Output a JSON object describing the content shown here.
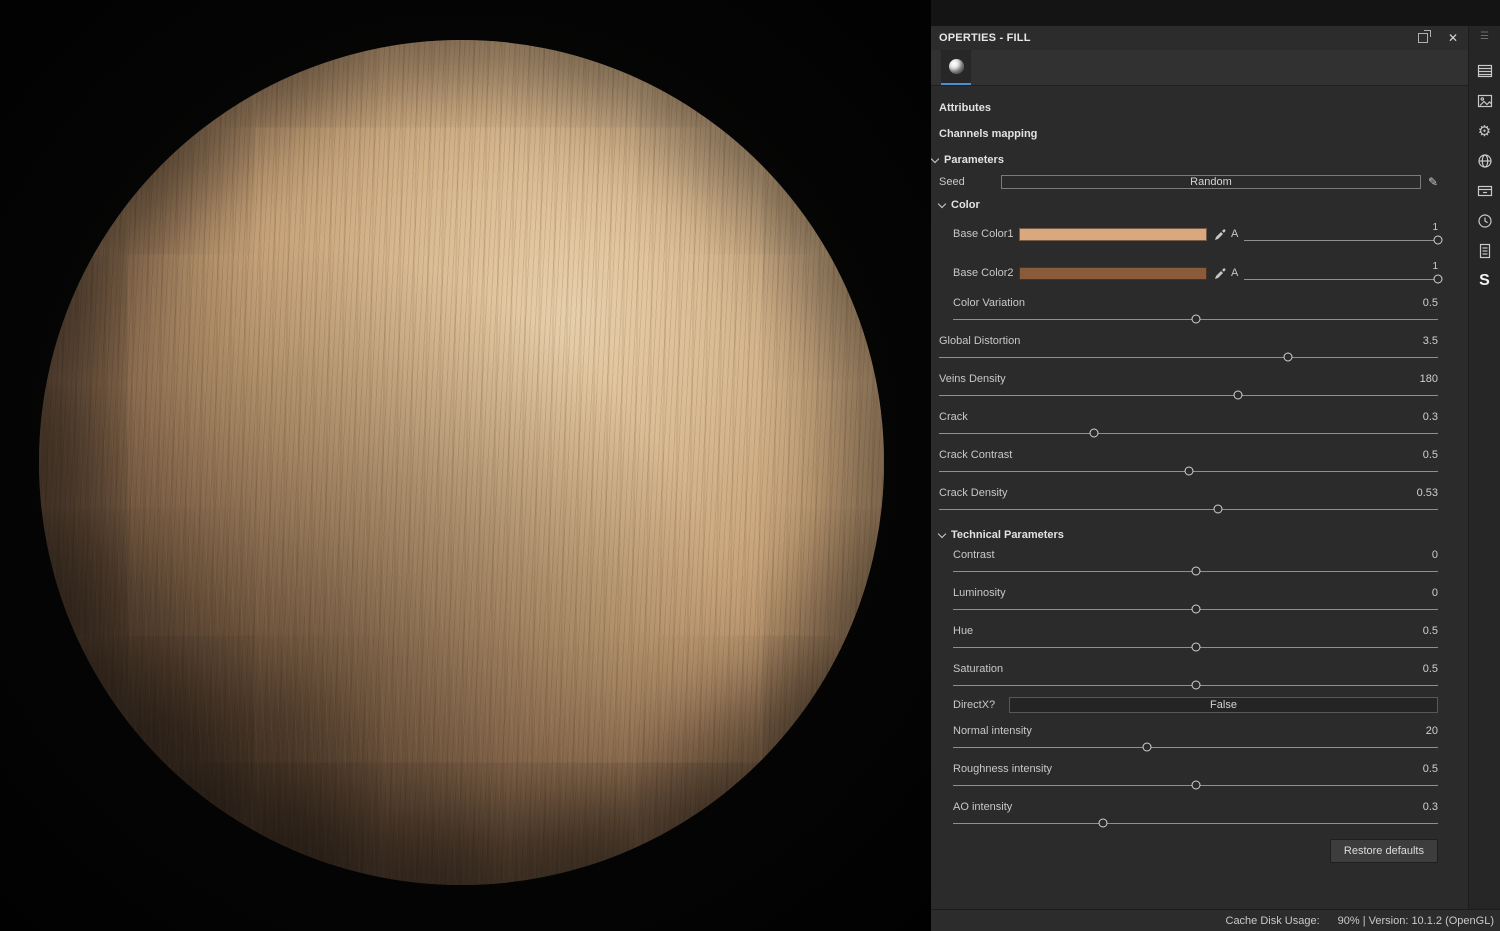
{
  "header": {
    "title": "OPERTIES - FILL"
  },
  "icons": {
    "close": "✕",
    "menu": "☰",
    "gear": "⚙",
    "pencil": "✎",
    "substance_logo": "S"
  },
  "colors": {
    "tab_accent": "#4a8fd4",
    "panel_background": "#2b2b2b"
  },
  "sections": {
    "attributes": "Attributes",
    "channels_mapping": "Channels mapping",
    "parameters": "Parameters",
    "color": "Color",
    "technical_parameters": "Technical Parameters"
  },
  "seed": {
    "label": "Seed",
    "value": "Random"
  },
  "base_color1": {
    "label": "Base Color1",
    "alpha": "A",
    "value": "1",
    "swatch": "#d9a87f",
    "percent": 100
  },
  "base_color2": {
    "label": "Base Color2",
    "alpha": "A",
    "value": "1",
    "swatch": "#8a5b38",
    "percent": 100
  },
  "sliders": {
    "color_variation": {
      "label": "Color Variation",
      "value": "0.5",
      "percent": 50
    },
    "global_distortion": {
      "label": "Global Distortion",
      "value": "3.5",
      "percent": 70
    },
    "veins_density": {
      "label": "Veins Density",
      "value": "180",
      "percent": 60
    },
    "crack": {
      "label": "Crack",
      "value": "0.3",
      "percent": 31
    },
    "crack_contrast": {
      "label": "Crack Contrast",
      "value": "0.5",
      "percent": 50
    },
    "crack_density": {
      "label": "Crack Density",
      "value": "0.53",
      "percent": 56
    },
    "contrast": {
      "label": "Contrast",
      "value": "0",
      "percent": 50
    },
    "luminosity": {
      "label": "Luminosity",
      "value": "0",
      "percent": 50
    },
    "hue": {
      "label": "Hue",
      "value": "0.5",
      "percent": 50
    },
    "saturation": {
      "label": "Saturation",
      "value": "0.5",
      "percent": 50
    },
    "normal_intensity": {
      "label": "Normal intensity",
      "value": "20",
      "percent": 40
    },
    "roughness_intensity": {
      "label": "Roughness intensity",
      "value": "0.5",
      "percent": 50
    },
    "ao_intensity": {
      "label": "AO intensity",
      "value": "0.3",
      "percent": 31
    }
  },
  "directx": {
    "label": "DirectX?",
    "value": "False"
  },
  "buttons": {
    "restore_defaults": "Restore defaults"
  },
  "statusbar": {
    "cache_label": "Cache Disk Usage:",
    "info": "90% | Version: 10.1.2 (OpenGL)"
  }
}
